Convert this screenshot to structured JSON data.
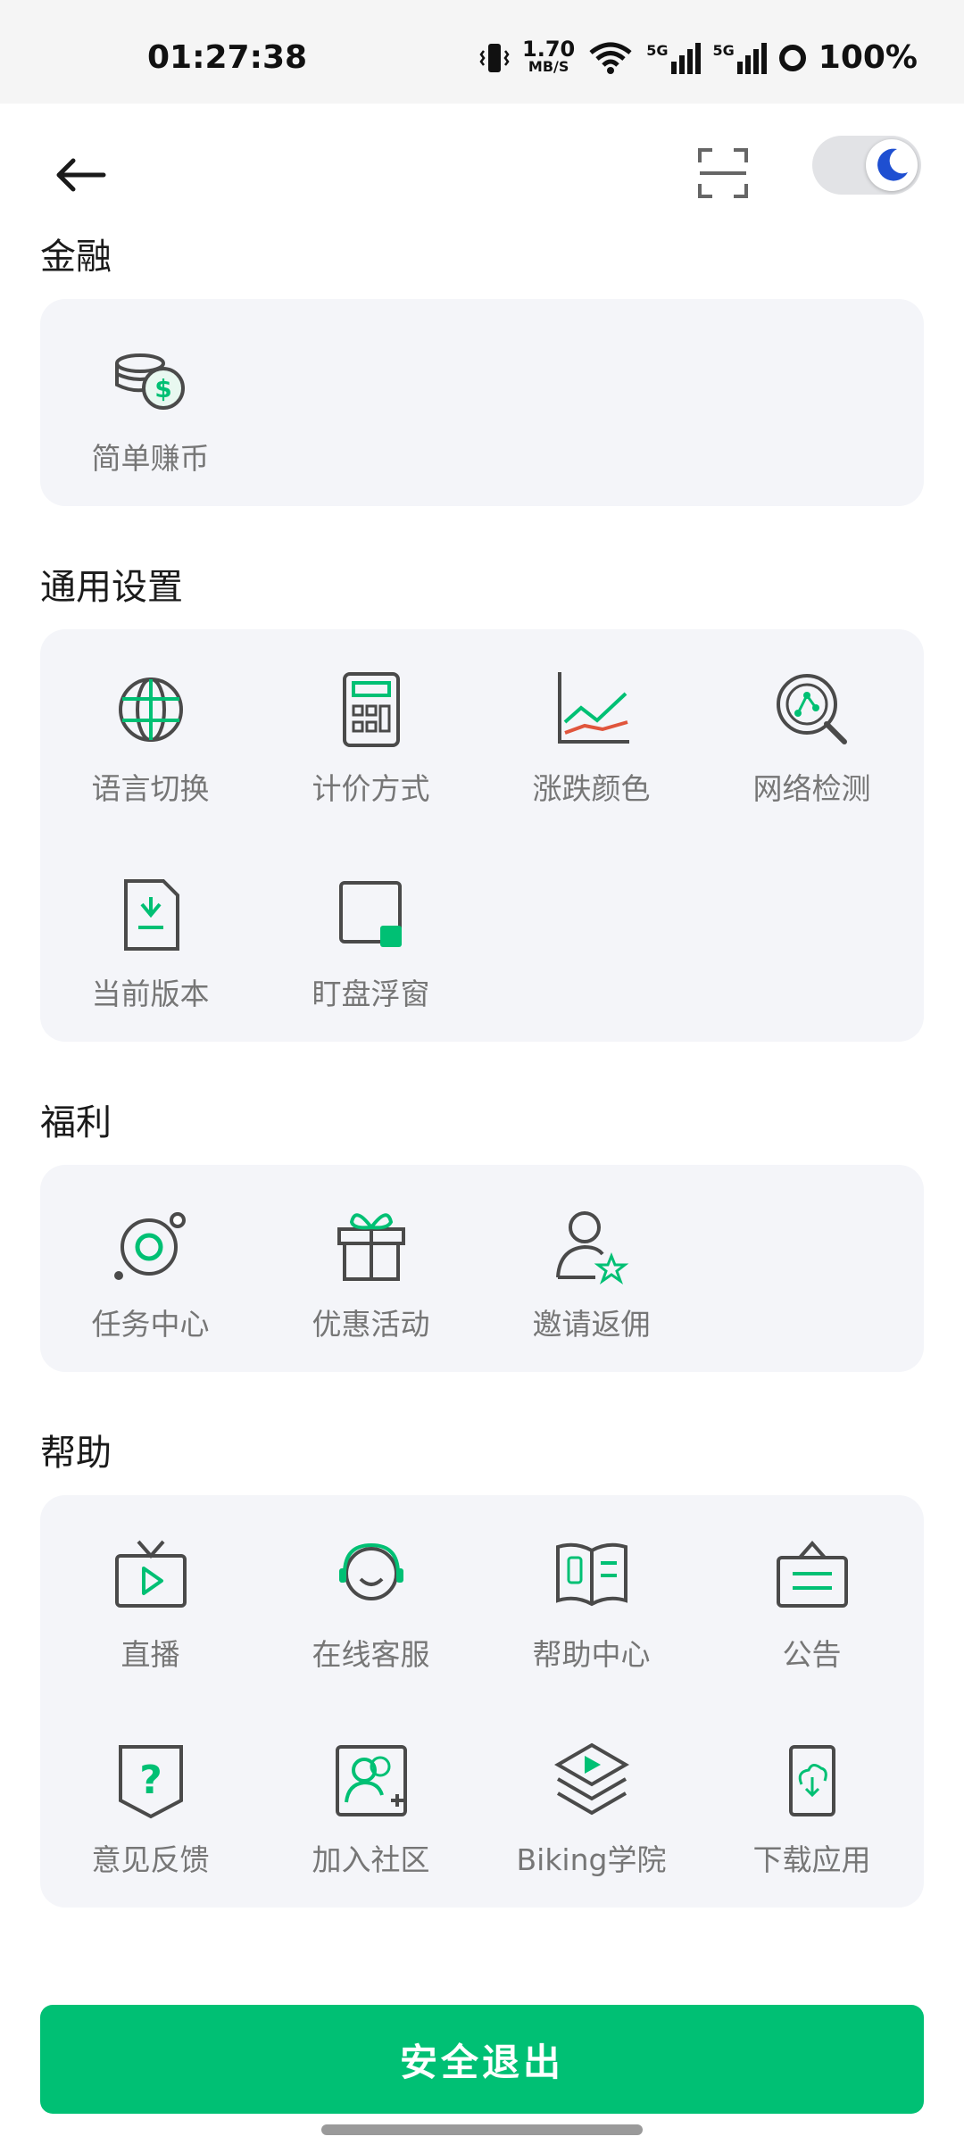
{
  "status_bar": {
    "time": "01:27:38",
    "speed_value": "1.70",
    "speed_unit": "MB/S",
    "net1": "5G",
    "net2": "5G",
    "battery": "100%"
  },
  "sections": {
    "finance": {
      "title": "金融",
      "items": [
        {
          "label": "简单赚币",
          "icon": "coins-dollar-icon"
        }
      ]
    },
    "general": {
      "title": "通用设置",
      "items": [
        {
          "label": "语言切换",
          "icon": "globe-icon"
        },
        {
          "label": "计价方式",
          "icon": "calculator-icon"
        },
        {
          "label": "涨跌颜色",
          "icon": "chart-lines-icon"
        },
        {
          "label": "网络检测",
          "icon": "network-search-icon"
        },
        {
          "label": "当前版本",
          "icon": "version-file-icon"
        },
        {
          "label": "盯盘浮窗",
          "icon": "floating-window-icon"
        }
      ]
    },
    "welfare": {
      "title": "福利",
      "items": [
        {
          "label": "任务中心",
          "icon": "orbit-target-icon"
        },
        {
          "label": "优惠活动",
          "icon": "gift-icon"
        },
        {
          "label": "邀请返佣",
          "icon": "user-star-icon"
        }
      ]
    },
    "help": {
      "title": "帮助",
      "items": [
        {
          "label": "直播",
          "icon": "tv-play-icon"
        },
        {
          "label": "在线客服",
          "icon": "headset-icon"
        },
        {
          "label": "帮助中心",
          "icon": "book-icon"
        },
        {
          "label": "公告",
          "icon": "announcement-icon"
        },
        {
          "label": "意见反馈",
          "icon": "question-shield-icon"
        },
        {
          "label": "加入社区",
          "icon": "community-add-icon"
        },
        {
          "label": "Biking学院",
          "icon": "academy-stack-icon"
        },
        {
          "label": "下载应用",
          "icon": "download-app-icon"
        }
      ]
    }
  },
  "logout": {
    "label": "安全退出"
  },
  "colors": {
    "accent": "#00c074",
    "card_bg": "#f4f5f9",
    "label": "#767676",
    "moon": "#1e4fd1"
  }
}
